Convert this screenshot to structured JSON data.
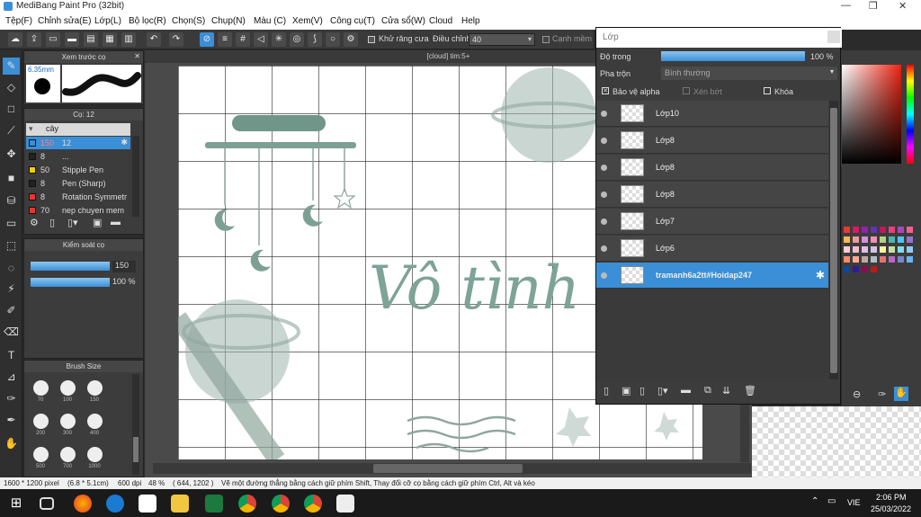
{
  "app": {
    "title": "MediBang Paint Pro (32bit)"
  },
  "menu": [
    "Tệp(F)",
    "Chỉnh sửa(E)",
    "Lớp(L)",
    "Bộ lọc(R)",
    "Chọn(S)",
    "Chụp(N)",
    "Màu (C)",
    "Xem(V)",
    "Công cụ(T)",
    "Cửa sổ(W)",
    "Cloud",
    "Help"
  ],
  "toolbar": {
    "antialias": "Khử răng cưa",
    "adjust": "Điều chỉnh",
    "adjust_value": "40",
    "snap": "Cạnh mềm"
  },
  "brush_preview": {
    "title": "Xem trước cọ",
    "size": "6.35mm"
  },
  "brush_list": {
    "title": "Cọ: 12",
    "group": "cây",
    "items": [
      {
        "size": "150",
        "name": "12"
      },
      {
        "size": "8",
        "name": "..."
      },
      {
        "size": "50",
        "name": "Stipple Pen"
      },
      {
        "size": "8",
        "name": "Pen (Sharp)"
      },
      {
        "size": "8",
        "name": "Rotation Symmetr"
      },
      {
        "size": "70",
        "name": "nep chuyen mem"
      }
    ]
  },
  "brush_control": {
    "title": "Kiểm soát cọ",
    "size_val": "150",
    "opacity_val": "100 %"
  },
  "brush_size": {
    "title": "Brush Size",
    "sizes": [
      "70",
      "100",
      "150",
      "200",
      "300",
      "400",
      "500",
      "700",
      "1000"
    ]
  },
  "canvas": {
    "tab": "[cloud] tim:5+",
    "text": "Vô tình"
  },
  "layer": {
    "title": "Lớp",
    "opacity_label": "Độ trong",
    "opacity_val": "100 %",
    "blend_label": "Pha trộn",
    "blend_val": "Bình thường",
    "protect_alpha": "Bảo vệ alpha",
    "clip": "Xén bớt",
    "lock": "Khóa",
    "layers": [
      "Lớp10",
      "Lớp8",
      "Lớp8",
      "Lớp8",
      "Lớp7",
      "Lớp6",
      "tramanh6a2tt#Hoidap247"
    ]
  },
  "status": {
    "pixel": "1600 * 1200 pixel",
    "cm": "(6.8 * 5.1cm)",
    "dpi": "600 dpi",
    "zoom": "48 %",
    "coord": "( 644, 1202 )",
    "hint": "Vẽ một đường thẳng bằng cách giữ phím Shift, Thay đổi cỡ cọ bằng cách giữ phím Ctrl, Alt và kéo"
  },
  "taskbar": {
    "lang": "VIE",
    "time": "2:06 PM",
    "date": "25/03/2022"
  }
}
